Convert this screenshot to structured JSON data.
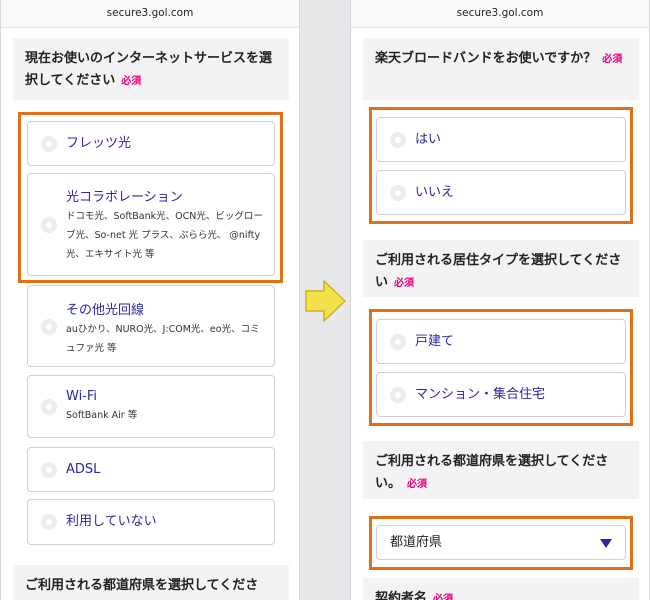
{
  "left": {
    "url": "secure3.gol.com",
    "question": "現在お使いのインターネットサービスを選択してください",
    "required": "必須",
    "options": [
      {
        "title": "フレッツ光",
        "sub": ""
      },
      {
        "title": "光コラボレーション",
        "sub": "ドコモ光、SoftBank光、OCN光、ビッグローブ光、So-net 光 プラス、ぷらら光、 @nifty光、エキサイト光 等"
      },
      {
        "title": "その他光回線",
        "sub": "auひかり、NURO光、J:COM光、eo光、コミュファ光 等"
      },
      {
        "title": "Wi-Fi",
        "sub": "SoftBank Air 等"
      },
      {
        "title": "ADSL",
        "sub": ""
      },
      {
        "title": "利用していない",
        "sub": ""
      }
    ],
    "next_question": "ご利用される都道府県を選択してくださ"
  },
  "right": {
    "url": "secure3.gol.com",
    "q1": "楽天ブロードバンドをお使いですか？",
    "q1_options": [
      "はい",
      "いいえ"
    ],
    "q2": "ご利用される居住タイプを選択してください",
    "q2_options": [
      "戸建て",
      "マンション・集合住宅"
    ],
    "q3": "ご利用される都道府県を選択してください。",
    "select_value": "都道府県",
    "next_question": "契約者名",
    "required": "必須"
  },
  "colors": {
    "highlight": "#e07018",
    "required": "#e5007f",
    "option_text": "#2a2aa0",
    "arrow": "#f5e14a"
  }
}
